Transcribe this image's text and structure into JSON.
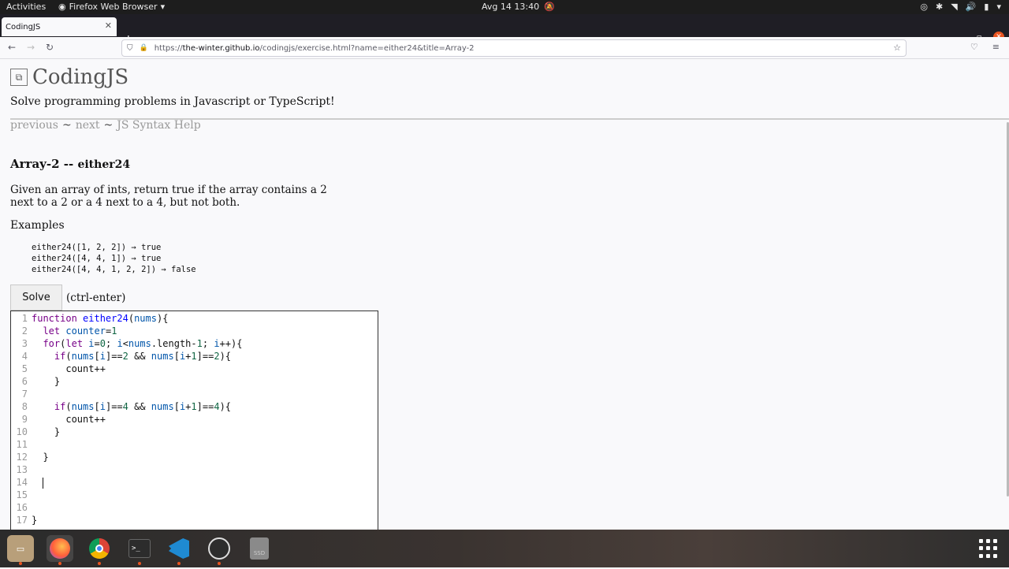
{
  "system": {
    "activities": "Activities",
    "app_name": "Firefox Web Browser",
    "clock": "Avg 14  13:40"
  },
  "browser": {
    "tab_title": "CodingJS",
    "url_prefix": "https://",
    "url_domain": "the-winter.github.io",
    "url_path": "/codingjs/exercise.html?name=either24&title=Array-2"
  },
  "page": {
    "logo_title": "CodingJS",
    "tagline": "Solve programming problems in Javascript or TypeScript!",
    "nav": {
      "previous": "previous",
      "sep1": "~",
      "next": "next",
      "sep2": "~",
      "syntax_help": "JS Syntax Help"
    },
    "problem_category": "Array-2 --",
    "problem_name": "either24",
    "description": "Given an array of ints, return true if the array contains a 2 next to a 2 or a 4 next to a 4, but not both.",
    "examples_label": "Examples",
    "examples": [
      "either24([1, 2, 2]) → true",
      "either24([4, 4, 1]) → true",
      "either24([4, 4, 1, 2, 2]) → false"
    ],
    "solve_label": "Solve",
    "solve_hint": "(ctrl-enter)"
  },
  "editor": {
    "line_numbers": [
      "1",
      "2",
      "3",
      "4",
      "5",
      "6",
      "7",
      "8",
      "9",
      "10",
      "11",
      "12",
      "13",
      "14",
      "15",
      "16",
      "17"
    ]
  }
}
